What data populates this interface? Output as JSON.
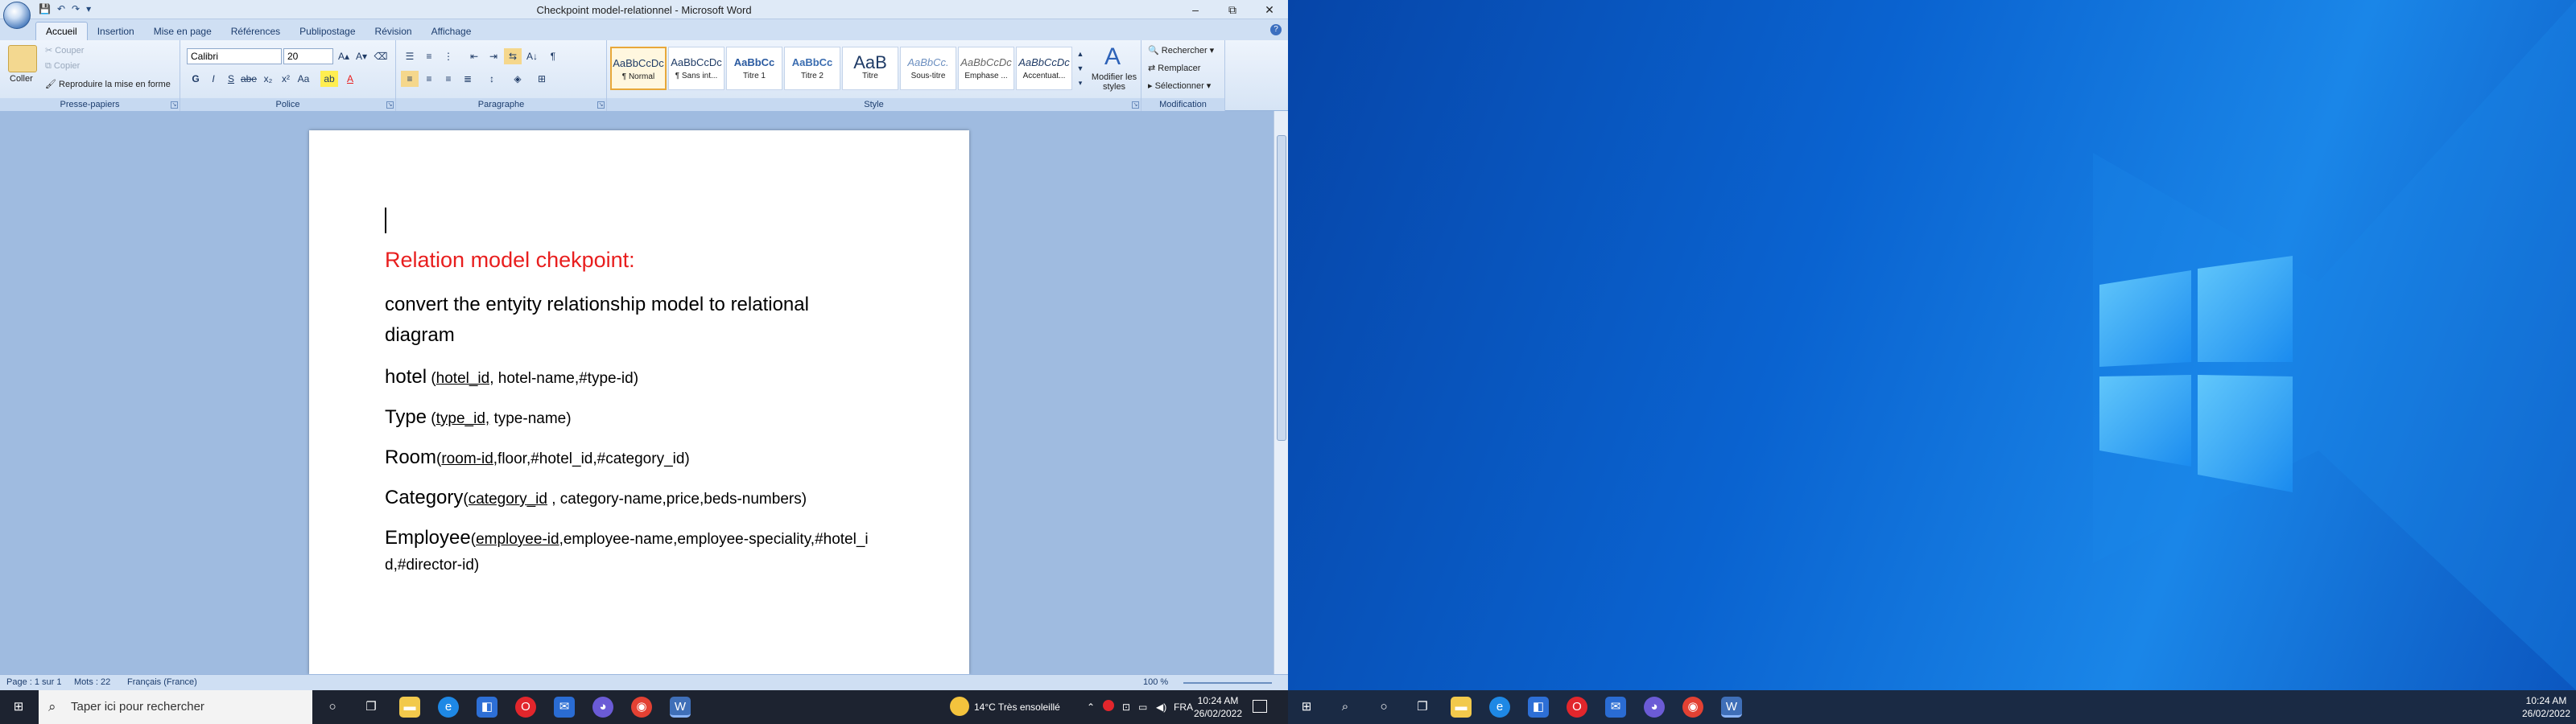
{
  "window": {
    "title": "Checkpoint model-relationnel - Microsoft Word",
    "minimize": "–",
    "maximize": "⧉",
    "close": "✕"
  },
  "qat": {
    "save": "💾",
    "undo": "↶",
    "redo": "↷",
    "more": "▾"
  },
  "tabs": [
    "Accueil",
    "Insertion",
    "Mise en page",
    "Références",
    "Publipostage",
    "Révision",
    "Affichage"
  ],
  "ribbon": {
    "clipboard": {
      "label": "Presse-papiers",
      "paste": "Coller",
      "cut": "Couper",
      "copy": "Copier",
      "format_painter": "Reproduire la mise en forme"
    },
    "font": {
      "label": "Police",
      "font_name": "Calibri",
      "font_size": "20"
    },
    "paragraph": {
      "label": "Paragraphe"
    },
    "styles": {
      "label": "Style",
      "change_styles": "Modifier les styles",
      "items": [
        {
          "sample": "AaBbCcDc",
          "name": "¶ Normal"
        },
        {
          "sample": "AaBbCcDc",
          "name": "¶ Sans int..."
        },
        {
          "sample": "AaBbCc",
          "name": "Titre 1"
        },
        {
          "sample": "AaBbCc",
          "name": "Titre 2"
        },
        {
          "sample": "AaB",
          "name": "Titre"
        },
        {
          "sample": "AaBbCc.",
          "name": "Sous-titre"
        },
        {
          "sample": "AaBbCcDc",
          "name": "Emphase ..."
        },
        {
          "sample": "AaBbCcDc",
          "name": "Accentuat..."
        }
      ]
    },
    "editing": {
      "label": "Modification",
      "find": "Rechercher",
      "replace": "Remplacer",
      "select": "Sélectionner"
    }
  },
  "document": {
    "title": "Relation model chekpoint:",
    "intro_line1": "convert the entyity relationship model to relational",
    "intro_line2": "diagram",
    "hotel": {
      "name": "hotel",
      "open": " (",
      "key": "hotel_id,",
      "rest": " hotel-name,#type-id)"
    },
    "type": {
      "name": "Type",
      "open": " (",
      "key": "type_id,",
      "rest": " type-name)"
    },
    "room": {
      "name": "Room",
      "open": "(",
      "key": "room-id",
      "rest": ",floor,#hotel_id,#category_id)"
    },
    "category": {
      "name": "Category",
      "open": "(",
      "key": "category_id",
      "rest": " , category-name,price,beds-numbers)"
    },
    "employee": {
      "name": "Employee",
      "open": "(",
      "key": "employee-id",
      "rest": ",employee-name,employee-speciality,#hotel_i",
      "line2": "d,#director-id)"
    }
  },
  "status": {
    "page": "Page : 1 sur 1",
    "words": "Mots : 22",
    "language": "Français (France)",
    "zoom": "100 %"
  },
  "taskbar": {
    "search_placeholder": "Taper ici pour rechercher",
    "weather": "14°C  Très ensoleillé",
    "lang": "FRA",
    "time": "10:24 AM",
    "date": "26/02/2022"
  },
  "colors": {
    "title_red": "#e81e1e",
    "ribbon_blue": "#cfdff3",
    "desktop_blue": "#0a63d0"
  }
}
